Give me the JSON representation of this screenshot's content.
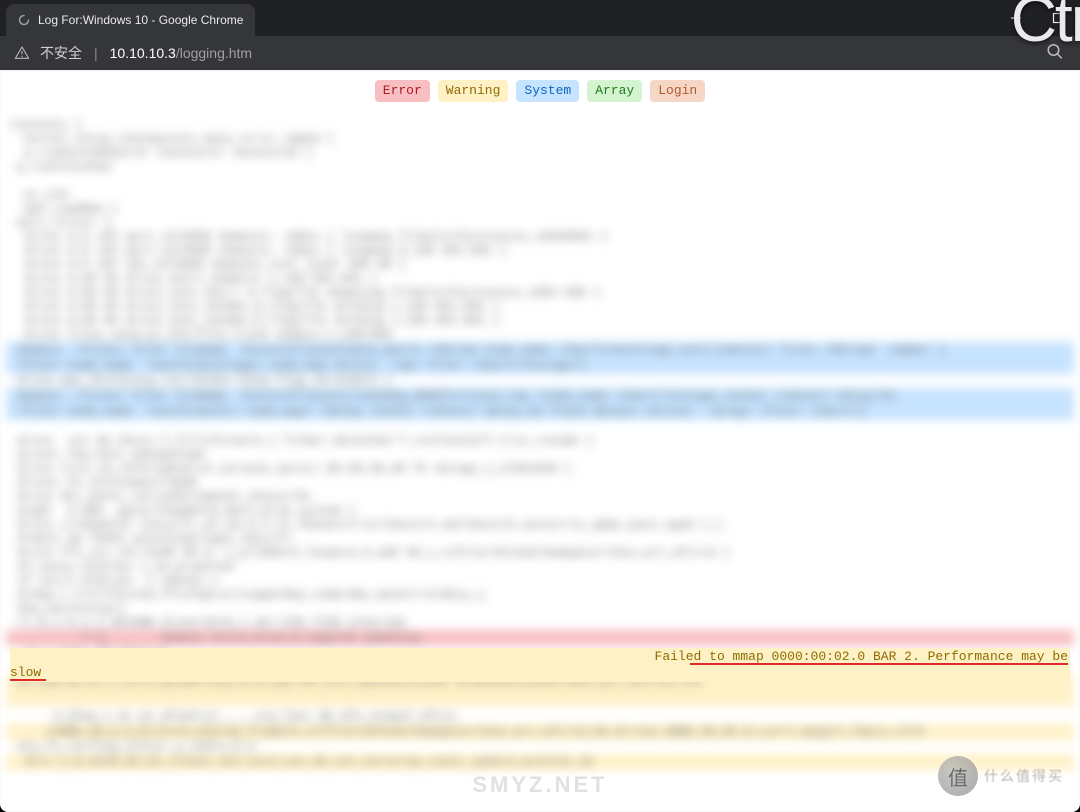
{
  "window": {
    "tab_title": "Log For:Windows 10 - Google Chrome",
    "overlay_text": "Ctr"
  },
  "addressbar": {
    "insecure_label": "不安全",
    "separator": "|",
    "host": "10.10.10.3",
    "path": "/logging.htm"
  },
  "filters": {
    "error": "Error",
    "warning": "Warning",
    "system": "System",
    "array": "Array",
    "login": "Login"
  },
  "visible_warning": {
    "line1_right": "Failed to mmap 0000:00:02.0 BAR 2. Performance may be",
    "line2": "slow"
  },
  "watermarks": {
    "center": "SMYZ.NET",
    "right_glyph": "值",
    "right_text": "什么值得买"
  }
}
